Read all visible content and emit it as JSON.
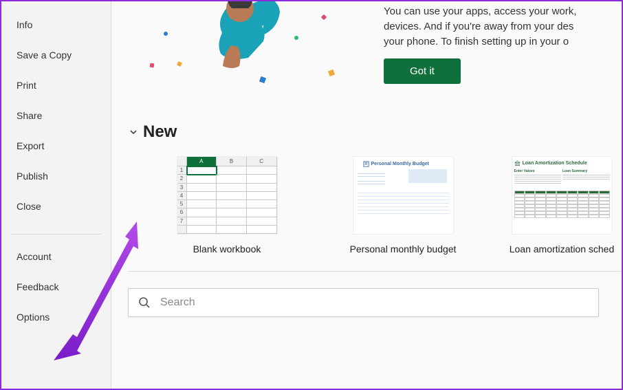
{
  "sidebar": {
    "items": [
      {
        "label": "Info"
      },
      {
        "label": "Save a Copy"
      },
      {
        "label": "Print"
      },
      {
        "label": "Share"
      },
      {
        "label": "Export"
      },
      {
        "label": "Publish"
      },
      {
        "label": "Close"
      }
    ],
    "footer_items": [
      {
        "label": "Account"
      },
      {
        "label": "Feedback"
      },
      {
        "label": "Options"
      }
    ]
  },
  "banner": {
    "text": "You can use your apps, access your work,\ndevices. And if you're away from your des\nyour phone. To finish setting up in your o",
    "button_label": "Got it"
  },
  "new_section": {
    "title": "New",
    "templates": [
      {
        "label": "Blank workbook"
      },
      {
        "label": "Personal monthly budget"
      },
      {
        "label": "Loan amortization sched"
      }
    ]
  },
  "search": {
    "placeholder": "Search"
  },
  "thumb_blank": {
    "cols": [
      "A",
      "B",
      "C"
    ],
    "rows": [
      "1",
      "2",
      "3",
      "4",
      "5",
      "6",
      "7"
    ]
  },
  "thumb_budget": {
    "title": "Personal Monthly Budget"
  },
  "thumb_loan": {
    "title": "Loan Amortization Schedule",
    "sub1": "Enter Values",
    "sub2": "Loan Summary"
  },
  "colors": {
    "accent": "#0f703b",
    "annotation": "#8b2bd9"
  }
}
